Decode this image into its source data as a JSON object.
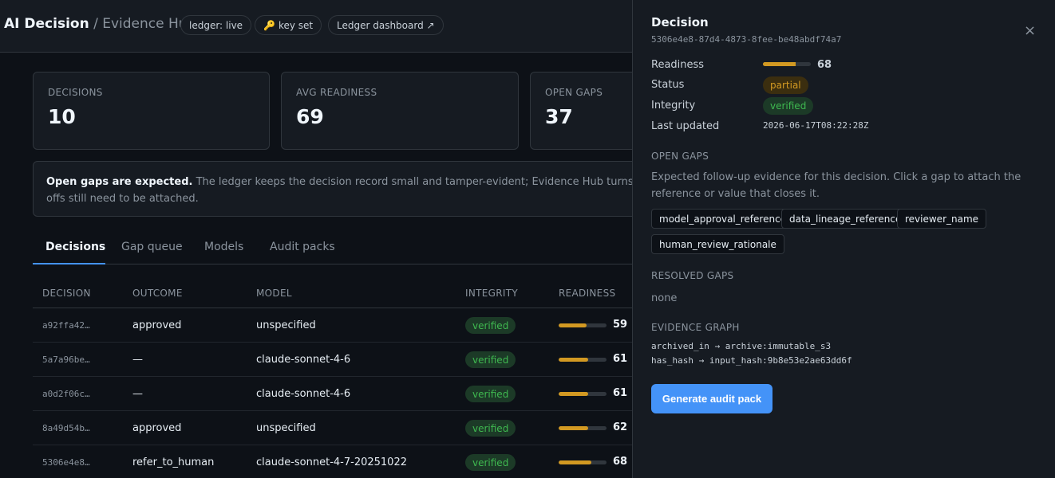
{
  "header": {
    "app_name": "AI Decision",
    "separator": " / ",
    "section": "Evidence Hub",
    "pills": {
      "ledger_status": "ledger: live",
      "key": "key set",
      "dashboard": "Ledger dashboard ↗"
    }
  },
  "stats": [
    {
      "label": "DECISIONS",
      "value": "10"
    },
    {
      "label": "AVG READINESS",
      "value": "69"
    },
    {
      "label": "OPEN GAPS",
      "value": "37"
    }
  ],
  "notice": {
    "strong": "Open gaps are expected.",
    "text": " The ledger keeps the decision record small and tamper-evident; Evidence Hub turns that rec",
    "line2": "offs still need to be attached."
  },
  "tabs": [
    "Decisions",
    "Gap queue",
    "Models",
    "Audit packs"
  ],
  "table": {
    "columns": [
      "DECISION",
      "OUTCOME",
      "MODEL",
      "INTEGRITY",
      "READINESS"
    ],
    "rows": [
      {
        "id": "a92ffa42…",
        "outcome": "approved",
        "model": "unspecified",
        "integrity": "verified",
        "readiness": 59
      },
      {
        "id": "5a7a96be…",
        "outcome": "—",
        "model": "claude-sonnet-4-6",
        "integrity": "verified",
        "readiness": 61
      },
      {
        "id": "a0d2f06c…",
        "outcome": "—",
        "model": "claude-sonnet-4-6",
        "integrity": "verified",
        "readiness": 61
      },
      {
        "id": "8a49d54b…",
        "outcome": "approved",
        "model": "unspecified",
        "integrity": "verified",
        "readiness": 62
      },
      {
        "id": "5306e4e8…",
        "outcome": "refer_to_human",
        "model": "claude-sonnet-4-7-20251022",
        "integrity": "verified",
        "readiness": 68
      }
    ]
  },
  "drawer": {
    "title": "Decision",
    "id": "5306e4e8-87d4-4873-8fee-be48abdf74a7",
    "close": "×",
    "readiness_label": "Readiness",
    "readiness_value": 68,
    "status_label": "Status",
    "status_value": "partial",
    "integrity_label": "Integrity",
    "integrity_value": "verified",
    "updated_label": "Last updated",
    "updated_value": "2026-06-17T08:22:28Z",
    "open_gaps_heading": "OPEN GAPS",
    "open_gaps_desc": "Expected follow-up evidence for this decision. Click a gap to attach the reference or value that closes it.",
    "gaps": [
      "model_approval_reference",
      "data_lineage_reference",
      "reviewer_name",
      "human_review_rationale"
    ],
    "resolved_heading": "RESOLVED GAPS",
    "resolved_value": "none",
    "graph_heading": "EVIDENCE GRAPH",
    "graph_edges": [
      "archived_in → archive:immutable_s3",
      "has_hash → input_hash:9b8e53e2ae63dd6f"
    ],
    "button": "Generate audit pack"
  },
  "colors": {
    "background": "#0d1117",
    "panel": "#161b22",
    "accent": "#4493f8",
    "verified": "#3fb950",
    "partial": "#d29922"
  }
}
